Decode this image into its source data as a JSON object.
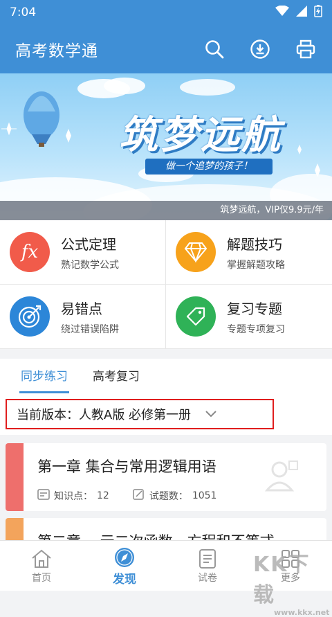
{
  "status": {
    "time": "7:04"
  },
  "appbar": {
    "title": "高考数学通",
    "icons": [
      "search-icon",
      "download-icon",
      "print-icon"
    ]
  },
  "banner": {
    "slogan": "筑梦远航",
    "subtitle": "做一个追梦的孩子！",
    "promo": "筑梦远航，VIP仅9.9元/年"
  },
  "features": [
    {
      "title": "公式定理",
      "subtitle": "熟记数学公式",
      "icon": "fx-icon",
      "color": "#f15b4a"
    },
    {
      "title": "解题技巧",
      "subtitle": "掌握解题攻略",
      "icon": "diamond-icon",
      "color": "#f7a21b"
    },
    {
      "title": "易错点",
      "subtitle": "绕过错误陷阱",
      "icon": "target-icon",
      "color": "#2c86d8"
    },
    {
      "title": "复习专题",
      "subtitle": "专题专项复习",
      "icon": "tag-icon",
      "color": "#2fb257"
    }
  ],
  "tabs": [
    {
      "label": "同步练习",
      "active": true
    },
    {
      "label": "高考复习",
      "active": false
    }
  ],
  "version": {
    "label": "当前版本：人教A版 必修第一册"
  },
  "chapters": [
    {
      "title": "第一章 集合与常用逻辑用语",
      "knowledge_label": "知识点：",
      "knowledge": "12",
      "questions_label": "试题数：",
      "questions": "1051",
      "color": "#ee6f6c"
    },
    {
      "title": "第二章  一元二次函数、方程和不等式",
      "color": "#f3a45c"
    }
  ],
  "bottom_nav": [
    {
      "label": "首页",
      "icon": "home-icon"
    },
    {
      "label": "发现",
      "icon": "compass-icon",
      "active": true
    },
    {
      "label": "试卷",
      "icon": "paper-icon"
    },
    {
      "label": "更多",
      "icon": "grid-icon"
    }
  ],
  "watermark": {
    "text": "KK下载",
    "url": "www.kkx.net"
  }
}
